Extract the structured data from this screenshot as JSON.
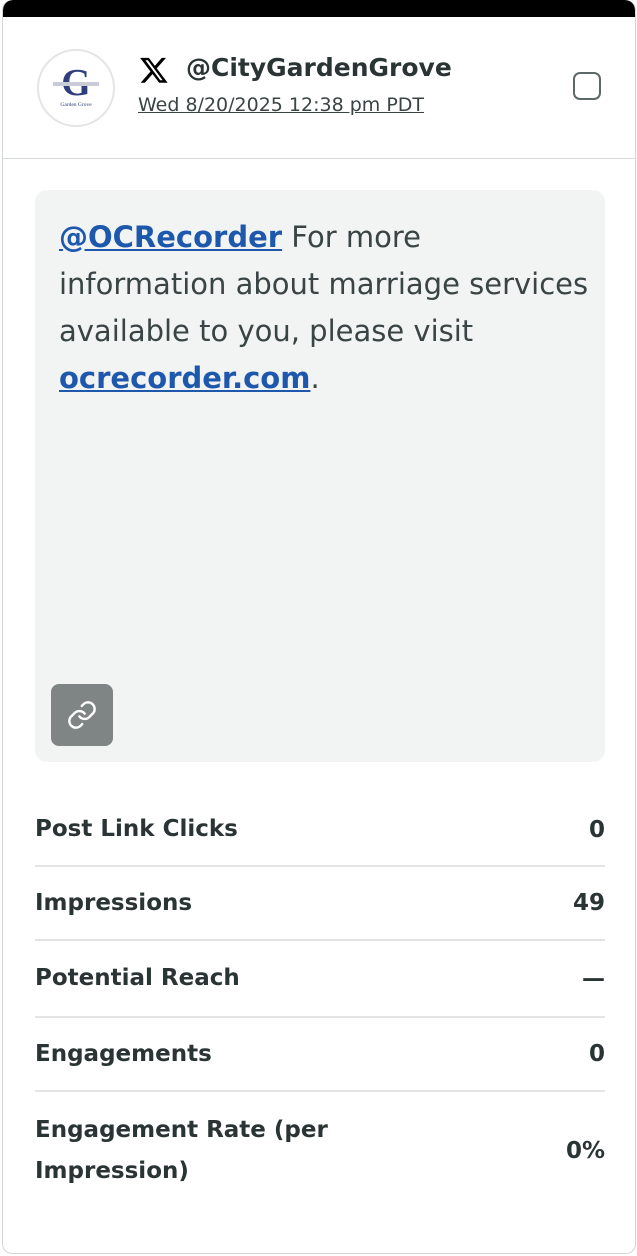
{
  "account": {
    "avatar_text": "G",
    "avatar_subtext": "Garden Grove",
    "network_icon": "x-logo-icon",
    "handle": "@CityGardenGrove",
    "timestamp": "Wed 8/20/2025 12:38 pm PDT"
  },
  "post": {
    "mention": "@OCRecorder",
    "text_before_link": " For more information about marriage services available to you, please visit ",
    "link": "ocrecorder.com",
    "text_after_link": ".",
    "link_icon": "link-icon"
  },
  "metrics": [
    {
      "label": "Post Link Clicks",
      "value": "0"
    },
    {
      "label": "Impressions",
      "value": "49"
    },
    {
      "label": "Potential Reach",
      "value": "—"
    },
    {
      "label": "Engagements",
      "value": "0"
    },
    {
      "label": "Engagement Rate (per Impression)",
      "value": "0%"
    }
  ],
  "colors": {
    "accent_link": "#1e58ad",
    "text": "#2b3434",
    "post_background": "#f2f3f3",
    "top_bar": "#000000"
  }
}
